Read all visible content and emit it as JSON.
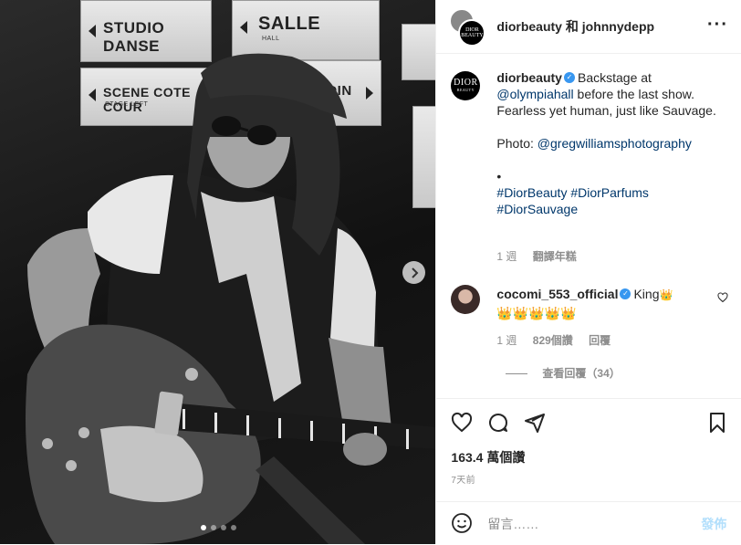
{
  "photo": {
    "signs": {
      "s1": "STUDIO DANSE",
      "s2": "SALLE",
      "s2_sub": "HALL",
      "s3": "SCENE COTE COUR",
      "s3_sub": "STAGE LEFT",
      "s4": "RDIN"
    },
    "carousel": {
      "count": 4,
      "active": 1
    }
  },
  "header": {
    "names": "diorbeauty 和 johnnydepp",
    "avatar_text_top": "DIOR",
    "avatar_text_bottom": "BEAUTY"
  },
  "caption": {
    "avatar_top": "DIOR",
    "avatar_bottom": "BEAUTY",
    "username": "diorbeauty",
    "text1": "Backstage at ",
    "mention1": "@olympiahall",
    "text2": " before the last show. Fearless yet human, just like Sauvage.",
    "photo_label": "Photo: ",
    "mention2": "@gregwilliamsphotography",
    "bullet": "•",
    "hashtags": "#DiorBeauty #DiorParfums #DiorSauvage",
    "time": "1 週",
    "translate": "翻譯年糕"
  },
  "comment": {
    "username": "cocomi_553_official",
    "text": "King",
    "crowns_line": "👑👑👑👑👑",
    "time": "1 週",
    "likes": "829個讚",
    "reply": "回覆",
    "view_replies": "查看回覆（34）"
  },
  "post": {
    "likes": "163.4 萬個讚",
    "time": "7天前"
  },
  "add_comment": {
    "placeholder": "留言……",
    "post_label": "發佈"
  },
  "colors": {
    "verified": "#3897f0",
    "link": "#00376b",
    "post_button": "#b2dffc"
  }
}
